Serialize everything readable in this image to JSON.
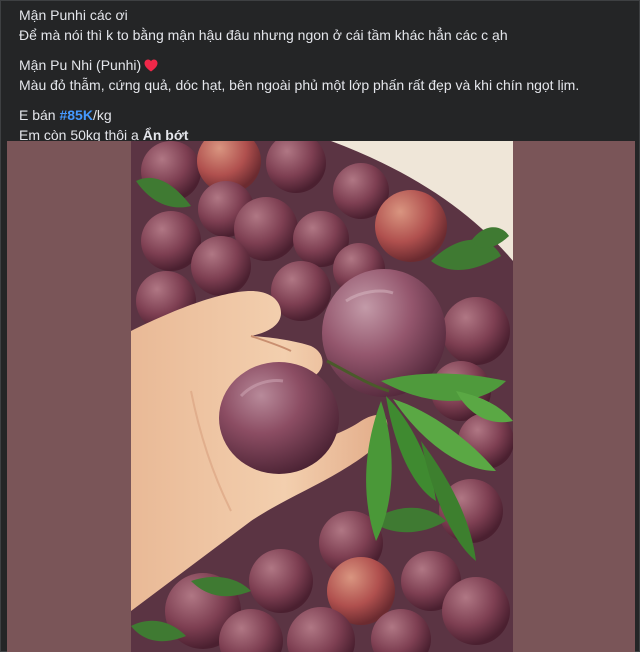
{
  "post": {
    "line1": "Mận Punhi các ơi",
    "line2": "Để mà nói thì k to bằng mận hậu đâu nhưng ngon ở cái tầm khác hẳn các c ạh",
    "line3": "Mận Pu Nhi (Punhi)",
    "line4": "Màu đỏ thẫm, cứng quả, dóc hạt, bên ngoài phủ một lớp phấn rất đẹp và khi chín ngọt lịm.",
    "price_prefix": "E bán ",
    "price_tag": "#85K",
    "price_suffix": "/kg",
    "stock_text": "Em còn 50kg thôi ạ ",
    "see_less": "Ẩn bớt"
  },
  "icons": {
    "heart": "red-heart-icon"
  },
  "colors": {
    "background": "#242526",
    "text": "#e4e6eb",
    "hashtag": "#4599ff",
    "heart": "#f02849",
    "media_backdrop": "#7a5558"
  }
}
